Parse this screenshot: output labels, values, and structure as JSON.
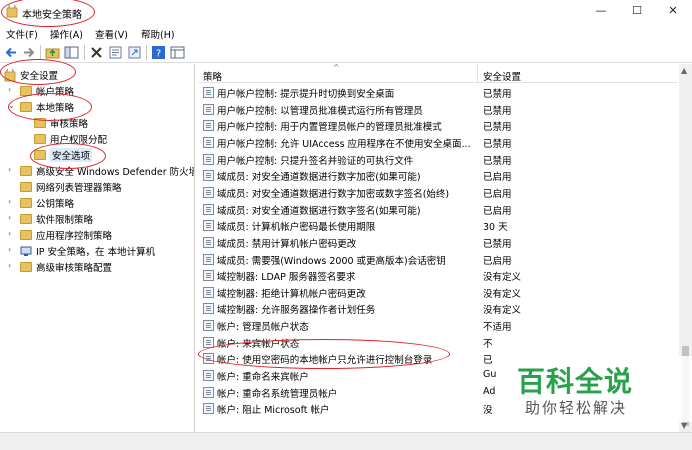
{
  "window": {
    "title": "本地安全策略",
    "controls": {
      "minimize": "—",
      "maximize": "☐",
      "close": "✕"
    }
  },
  "menu": [
    "文件(F)",
    "操作(A)",
    "查看(V)",
    "帮助(H)"
  ],
  "tree": [
    {
      "label": "安全设置"
    },
    {
      "label": "帐户策略"
    },
    {
      "label": "本地策略"
    },
    {
      "label": "审核策略"
    },
    {
      "label": "用户权限分配"
    },
    {
      "label": "安全选项"
    },
    {
      "label": "高级安全 Windows Defender 防火墙"
    },
    {
      "label": "网络列表管理器策略"
    },
    {
      "label": "公钥策略"
    },
    {
      "label": "软件限制策略"
    },
    {
      "label": "应用程序控制策略"
    },
    {
      "label": "IP 安全策略，在 本地计算机"
    },
    {
      "label": "高级审核策略配置"
    }
  ],
  "list": {
    "col_policy": "策略",
    "col_setting": "安全设置",
    "rows": [
      {
        "policy": "用户帐户控制: 提示提升时切换到安全桌面",
        "setting": "已禁用"
      },
      {
        "policy": "用户帐户控制: 以管理员批准模式运行所有管理员",
        "setting": "已禁用"
      },
      {
        "policy": "用户帐户控制: 用于内置管理员帐户的管理员批准模式",
        "setting": "已禁用"
      },
      {
        "policy": "用户帐户控制: 允许 UIAccess 应用程序在不使用安全桌面...",
        "setting": "已禁用"
      },
      {
        "policy": "用户帐户控制: 只提升签名并验证的可执行文件",
        "setting": "已禁用"
      },
      {
        "policy": "域成员: 对安全通道数据进行数字加密(如果可能)",
        "setting": "已启用"
      },
      {
        "policy": "域成员: 对安全通道数据进行数字加密或数字签名(始终)",
        "setting": "已启用"
      },
      {
        "policy": "域成员: 对安全通道数据进行数字签名(如果可能)",
        "setting": "已启用"
      },
      {
        "policy": "域成员: 计算机帐户密码最长使用期限",
        "setting": "30 天"
      },
      {
        "policy": "域成员: 禁用计算机帐户密码更改",
        "setting": "已禁用"
      },
      {
        "policy": "域成员: 需要强(Windows 2000 或更高版本)会话密钥",
        "setting": "已启用"
      },
      {
        "policy": "域控制器: LDAP 服务器签名要求",
        "setting": "没有定义"
      },
      {
        "policy": "域控制器: 拒绝计算机帐户密码更改",
        "setting": "没有定义"
      },
      {
        "policy": "域控制器: 允许服务器操作者计划任务",
        "setting": "没有定义"
      },
      {
        "policy": "帐户: 管理员帐户状态",
        "setting": "不适用"
      },
      {
        "policy": "帐户: 来宾帐户状态",
        "setting": "不"
      },
      {
        "policy": "帐户: 使用空密码的本地帐户只允许进行控制台登录",
        "setting": "已"
      },
      {
        "policy": "帐户: 重命名来宾帐户",
        "setting": "Gu"
      },
      {
        "policy": "帐户: 重命名系统管理员帐户",
        "setting": "Ad"
      },
      {
        "policy": "帐户: 阻止 Microsoft 帐户",
        "setting": "没"
      }
    ]
  },
  "watermark": {
    "title": "百科全说",
    "subtitle": "助你轻松解决"
  },
  "colors": {
    "annotation": "#e0202a",
    "watermark_green": "#27a24a",
    "folder": "#e8c25f"
  }
}
